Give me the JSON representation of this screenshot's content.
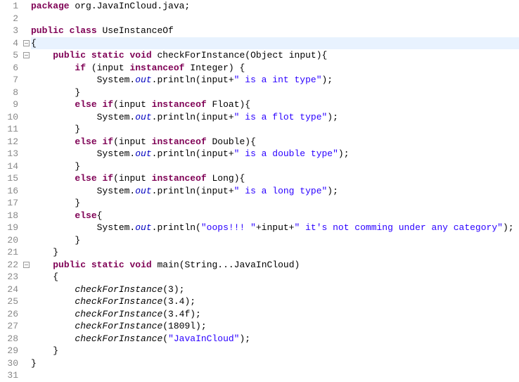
{
  "lines": [
    {
      "n": 1,
      "indent": 0,
      "marker": "",
      "highlight": false,
      "tokens": [
        [
          "kw",
          "package"
        ],
        [
          "",
          " org.JavaInCloud.java;"
        ]
      ]
    },
    {
      "n": 2,
      "indent": 0,
      "marker": "",
      "highlight": false,
      "tokens": [
        [
          "",
          ""
        ]
      ]
    },
    {
      "n": 3,
      "indent": 0,
      "marker": "",
      "highlight": false,
      "tokens": [
        [
          "kw",
          "public"
        ],
        [
          "",
          " "
        ],
        [
          "kw",
          "class"
        ],
        [
          "",
          " UseInstanceOf"
        ]
      ]
    },
    {
      "n": 4,
      "indent": 0,
      "marker": "fold",
      "highlight": true,
      "tokens": [
        [
          "",
          "{"
        ]
      ]
    },
    {
      "n": 5,
      "indent": 1,
      "marker": "fold",
      "highlight": false,
      "tokens": [
        [
          "kw",
          "public"
        ],
        [
          "",
          " "
        ],
        [
          "kw",
          "static"
        ],
        [
          "",
          " "
        ],
        [
          "kw",
          "void"
        ],
        [
          "",
          " checkForInstance(Object input){"
        ]
      ]
    },
    {
      "n": 6,
      "indent": 2,
      "marker": "",
      "highlight": false,
      "tokens": [
        [
          "kw",
          "if"
        ],
        [
          "",
          " (input "
        ],
        [
          "kw",
          "instanceof"
        ],
        [
          "",
          " Integer) {"
        ]
      ]
    },
    {
      "n": 7,
      "indent": 3,
      "marker": "",
      "highlight": false,
      "tokens": [
        [
          "",
          "System."
        ],
        [
          "field",
          "out"
        ],
        [
          "",
          ".println(input+"
        ],
        [
          "str",
          "\" is a int type\""
        ],
        [
          "",
          ");"
        ]
      ]
    },
    {
      "n": 8,
      "indent": 2,
      "marker": "",
      "highlight": false,
      "tokens": [
        [
          "",
          "}"
        ]
      ]
    },
    {
      "n": 9,
      "indent": 2,
      "marker": "",
      "highlight": false,
      "tokens": [
        [
          "kw",
          "else"
        ],
        [
          "",
          " "
        ],
        [
          "kw",
          "if"
        ],
        [
          "",
          "(input "
        ],
        [
          "kw",
          "instanceof"
        ],
        [
          "",
          " Float){"
        ]
      ]
    },
    {
      "n": 10,
      "indent": 3,
      "marker": "",
      "highlight": false,
      "tokens": [
        [
          "",
          "System."
        ],
        [
          "field",
          "out"
        ],
        [
          "",
          ".println(input+"
        ],
        [
          "str",
          "\" is a flot type\""
        ],
        [
          "",
          ");"
        ]
      ]
    },
    {
      "n": 11,
      "indent": 2,
      "marker": "",
      "highlight": false,
      "tokens": [
        [
          "",
          "}"
        ]
      ]
    },
    {
      "n": 12,
      "indent": 2,
      "marker": "",
      "highlight": false,
      "tokens": [
        [
          "kw",
          "else"
        ],
        [
          "",
          " "
        ],
        [
          "kw",
          "if"
        ],
        [
          "",
          "(input "
        ],
        [
          "kw",
          "instanceof"
        ],
        [
          "",
          " Double){"
        ]
      ]
    },
    {
      "n": 13,
      "indent": 3,
      "marker": "",
      "highlight": false,
      "tokens": [
        [
          "",
          "System."
        ],
        [
          "field",
          "out"
        ],
        [
          "",
          ".println(input+"
        ],
        [
          "str",
          "\" is a double type\""
        ],
        [
          "",
          ");"
        ]
      ]
    },
    {
      "n": 14,
      "indent": 2,
      "marker": "",
      "highlight": false,
      "tokens": [
        [
          "",
          "}"
        ]
      ]
    },
    {
      "n": 15,
      "indent": 2,
      "marker": "",
      "highlight": false,
      "tokens": [
        [
          "kw",
          "else"
        ],
        [
          "",
          " "
        ],
        [
          "kw",
          "if"
        ],
        [
          "",
          "(input "
        ],
        [
          "kw",
          "instanceof"
        ],
        [
          "",
          " Long){"
        ]
      ]
    },
    {
      "n": 16,
      "indent": 3,
      "marker": "",
      "highlight": false,
      "tokens": [
        [
          "",
          "System."
        ],
        [
          "field",
          "out"
        ],
        [
          "",
          ".println(input+"
        ],
        [
          "str",
          "\" is a long type\""
        ],
        [
          "",
          ");"
        ]
      ]
    },
    {
      "n": 17,
      "indent": 2,
      "marker": "",
      "highlight": false,
      "tokens": [
        [
          "",
          "}"
        ]
      ]
    },
    {
      "n": 18,
      "indent": 2,
      "marker": "",
      "highlight": false,
      "tokens": [
        [
          "kw",
          "else"
        ],
        [
          "",
          "{"
        ]
      ]
    },
    {
      "n": 19,
      "indent": 3,
      "marker": "",
      "highlight": false,
      "tokens": [
        [
          "",
          "System."
        ],
        [
          "field",
          "out"
        ],
        [
          "",
          ".println("
        ],
        [
          "str",
          "\"oops!!! \""
        ],
        [
          "",
          "+input+"
        ],
        [
          "str",
          "\" it's not comming under any category\""
        ],
        [
          "",
          ");"
        ]
      ]
    },
    {
      "n": 20,
      "indent": 2,
      "marker": "",
      "highlight": false,
      "tokens": [
        [
          "",
          "}"
        ]
      ]
    },
    {
      "n": 21,
      "indent": 1,
      "marker": "",
      "highlight": false,
      "tokens": [
        [
          "",
          "}"
        ]
      ]
    },
    {
      "n": 22,
      "indent": 1,
      "marker": "fold",
      "highlight": false,
      "tokens": [
        [
          "kw",
          "public"
        ],
        [
          "",
          " "
        ],
        [
          "kw",
          "static"
        ],
        [
          "",
          " "
        ],
        [
          "kw",
          "void"
        ],
        [
          "",
          " main(String...JavaInCloud)"
        ]
      ]
    },
    {
      "n": 23,
      "indent": 1,
      "marker": "",
      "highlight": false,
      "tokens": [
        [
          "",
          "{"
        ]
      ]
    },
    {
      "n": 24,
      "indent": 2,
      "marker": "",
      "highlight": false,
      "tokens": [
        [
          "method-static",
          "checkForInstance"
        ],
        [
          "",
          "(3);"
        ]
      ]
    },
    {
      "n": 25,
      "indent": 2,
      "marker": "",
      "highlight": false,
      "tokens": [
        [
          "method-static",
          "checkForInstance"
        ],
        [
          "",
          "(3.4);"
        ]
      ]
    },
    {
      "n": 26,
      "indent": 2,
      "marker": "",
      "highlight": false,
      "tokens": [
        [
          "method-static",
          "checkForInstance"
        ],
        [
          "",
          "(3.4f);"
        ]
      ]
    },
    {
      "n": 27,
      "indent": 2,
      "marker": "",
      "highlight": false,
      "tokens": [
        [
          "method-static",
          "checkForInstance"
        ],
        [
          "",
          "(1809l);"
        ]
      ]
    },
    {
      "n": 28,
      "indent": 2,
      "marker": "",
      "highlight": false,
      "tokens": [
        [
          "method-static",
          "checkForInstance"
        ],
        [
          "",
          "("
        ],
        [
          "str",
          "\"JavaInCloud\""
        ],
        [
          "",
          ");"
        ]
      ]
    },
    {
      "n": 29,
      "indent": 1,
      "marker": "",
      "highlight": false,
      "tokens": [
        [
          "",
          "}"
        ]
      ]
    },
    {
      "n": 30,
      "indent": 0,
      "marker": "",
      "highlight": false,
      "tokens": [
        [
          "",
          "}"
        ]
      ]
    },
    {
      "n": 31,
      "indent": 0,
      "marker": "",
      "highlight": false,
      "tokens": [
        [
          "",
          ""
        ]
      ]
    }
  ],
  "indent_unit": "    "
}
